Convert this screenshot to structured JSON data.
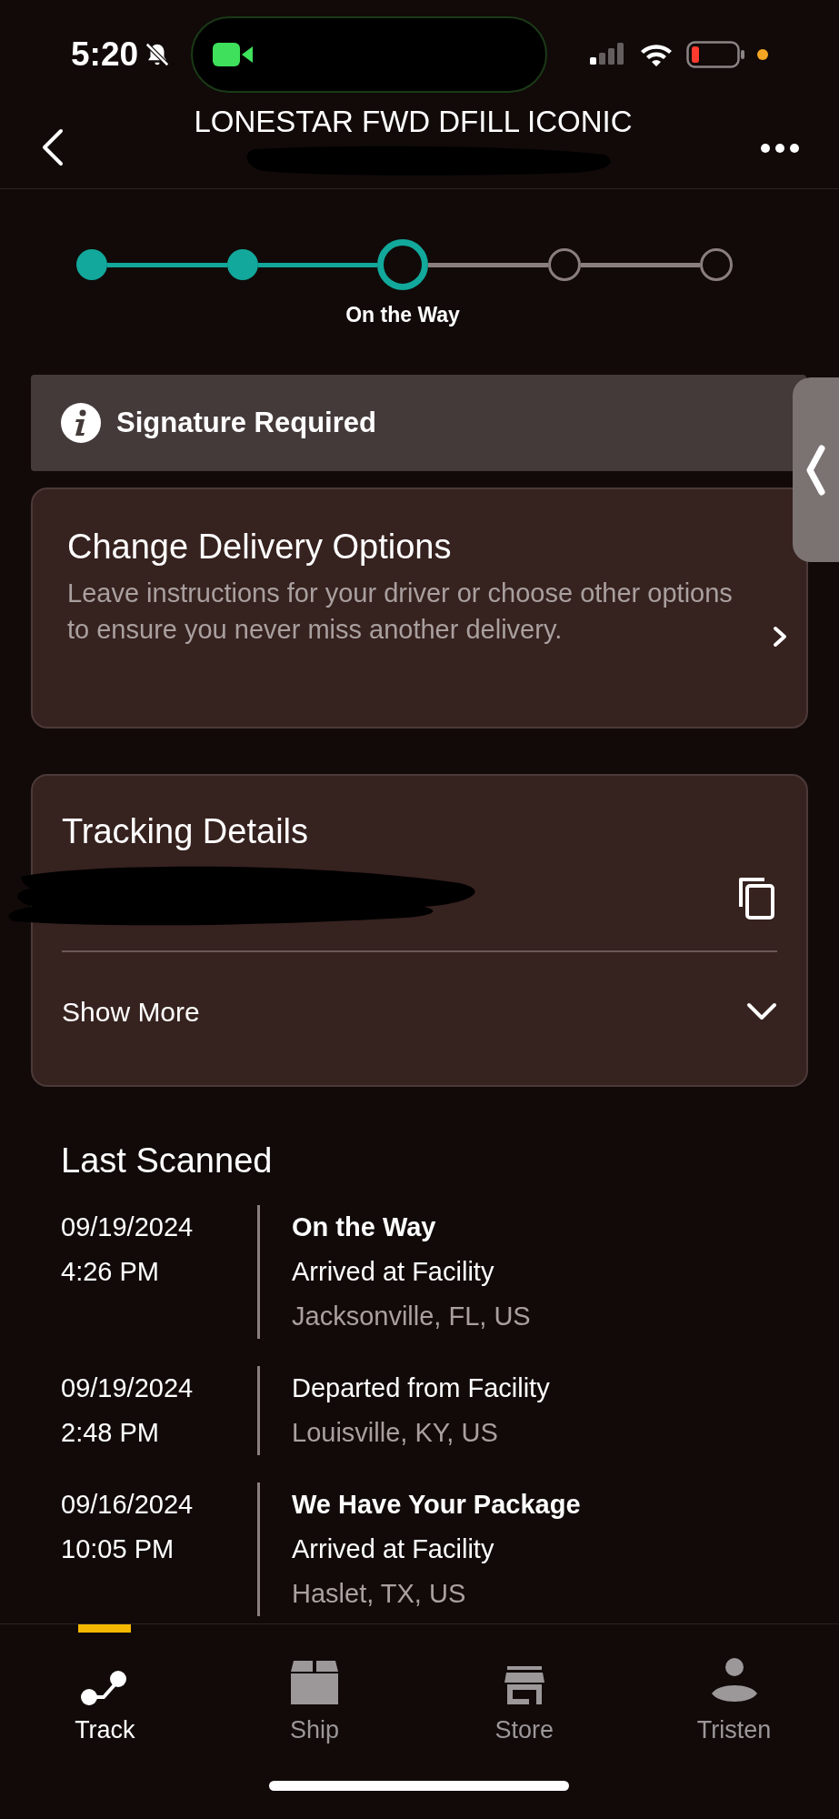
{
  "status_bar": {
    "time": "5:20"
  },
  "header": {
    "title": "LONESTAR FWD DFILL ICONIC"
  },
  "stepper": {
    "steps": [
      {
        "done": true,
        "current": false
      },
      {
        "done": true,
        "current": false
      },
      {
        "done": false,
        "current": true,
        "label": "On the Way"
      },
      {
        "done": false,
        "current": false
      },
      {
        "done": false,
        "current": false
      }
    ]
  },
  "notice": {
    "text": "Signature Required"
  },
  "delivery_options": {
    "title": "Change Delivery Options",
    "description": "Leave instructions for your driver or choose other options to ensure you never miss another delivery."
  },
  "tracking_details": {
    "title": "Tracking Details",
    "toggle": "Show More",
    "expanded": false
  },
  "last_scanned": {
    "heading": "Last Scanned",
    "events": [
      {
        "date": "09/19/2024",
        "time": "4:26 PM",
        "status": "On the Way",
        "description": "Arrived at Facility",
        "location": "Jacksonville, FL, US"
      },
      {
        "date": "09/19/2024",
        "time": "2:48 PM",
        "description": "Departed from Facility",
        "location": "Louisville, KY, US"
      },
      {
        "date": "09/16/2024",
        "time": "10:05 PM",
        "status": "We Have Your Package",
        "description": "Arrived at Facility",
        "location": "Haslet, TX, US"
      }
    ]
  },
  "nav": {
    "items": [
      {
        "kind": "track",
        "label": "Track",
        "selected": true
      },
      {
        "kind": "ship",
        "label": "Ship",
        "selected": false
      },
      {
        "kind": "store",
        "label": "Store",
        "selected": false
      },
      {
        "kind": "profile",
        "label": "Tristen",
        "selected": false
      }
    ]
  }
}
